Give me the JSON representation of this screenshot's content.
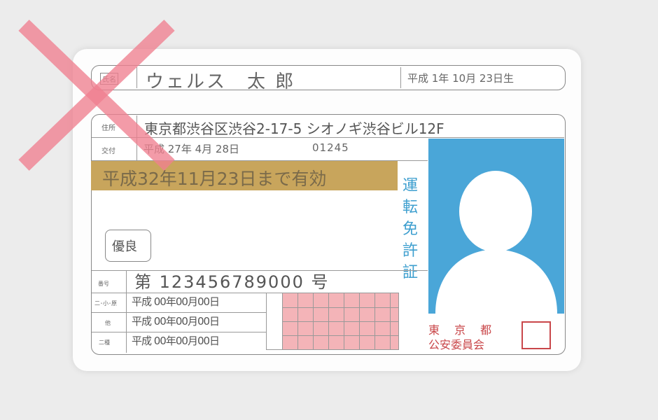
{
  "card": {
    "name_label": "氏名",
    "name": "ウェルス　太 郎",
    "birth_date": "平成 1年 10月 23日生",
    "address_label": "住所",
    "address": "東京都渋谷区渋谷2-17-5 シオノギ渋谷ビル12F",
    "issue_label": "交付",
    "issue_date": "平成 27年 4月 28日",
    "issue_number": "01245",
    "valid_until": "平成32年11月23日まで有効",
    "badge": "優良",
    "license_number_label": "番号",
    "license_number": "第 123456789000 号",
    "license_type_title_chars": [
      "運",
      "転",
      "免",
      "許",
      "証"
    ],
    "row_labels": [
      "二･小･原",
      "他",
      "二種"
    ],
    "row_dates": [
      "平成 00年00月00日",
      "平成 00年00月00日",
      "平成 00年00月00日"
    ],
    "authority_line1": "東 京 都",
    "authority_line2": "公安委員会",
    "colors": {
      "highlight": "#c8a55c",
      "photo_bg": "#4aa6d8",
      "title_blue": "#3e9fcf",
      "authority_red": "#c9474a",
      "grid_pink": "#f4b4b8",
      "cross": "#f08090"
    }
  }
}
